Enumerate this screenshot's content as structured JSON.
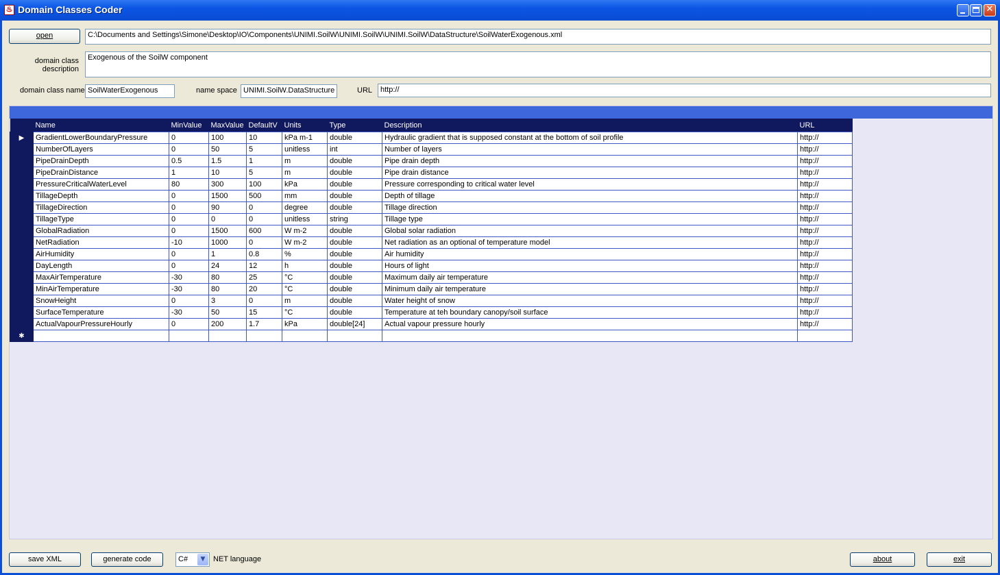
{
  "window": {
    "title": "Domain Classes Coder",
    "app_icon": "app-icon",
    "minimize": "_",
    "maximize": "□",
    "close": "✕"
  },
  "file": {
    "open_label": "open",
    "path": "C:\\Documents and Settings\\Simone\\Desktop\\IO\\Components\\UNIMI.SoilW\\UNIMI.SoilW\\UNIMI.SoilW\\DataStructure\\SoilWaterExogenous.xml"
  },
  "description": {
    "label": "domain class description",
    "value": "Exogenous of the SoilW component"
  },
  "class_name": {
    "label": "domain class name",
    "value": "SoilWaterExogenous"
  },
  "name_space": {
    "label": "name space",
    "value": "UNIMI.SoilW.DataStructure"
  },
  "url": {
    "label": "URL",
    "value": "http://"
  },
  "grid": {
    "columns": [
      "Name",
      "MinValue",
      "MaxValue",
      "DefaultV",
      "Units",
      "Type",
      "Description",
      "URL"
    ],
    "current_row_marker": "▶",
    "new_row_marker": "✱",
    "rows": [
      [
        "GradientLowerBoundaryPressure",
        "0",
        "100",
        "10",
        "kPa m-1",
        "double",
        "Hydraulic gradient that is supposed constant at the bottom of soil profile",
        "http://"
      ],
      [
        "NumberOfLayers",
        "0",
        "50",
        "5",
        "unitless",
        "int",
        "Number of layers",
        "http://"
      ],
      [
        "PipeDrainDepth",
        "0.5",
        "1.5",
        "1",
        "m",
        "double",
        "Pipe drain depth",
        "http://"
      ],
      [
        "PipeDrainDistance",
        "1",
        "10",
        "5",
        "m",
        "double",
        "Pipe drain distance",
        "http://"
      ],
      [
        "PressureCriticalWaterLevel",
        "80",
        "300",
        "100",
        "kPa",
        "double",
        "Pressure corresponding to critical water level",
        "http://"
      ],
      [
        "TillageDepth",
        "0",
        "1500",
        "500",
        "mm",
        "double",
        "Depth of tillage",
        "http://"
      ],
      [
        "TillageDirection",
        "0",
        "90",
        "0",
        "degree",
        "double",
        "Tillage direction",
        "http://"
      ],
      [
        "TillageType",
        "0",
        "0",
        "0",
        "unitless",
        "string",
        "Tillage type",
        "http://"
      ],
      [
        "GlobalRadiation",
        "0",
        "1500",
        "600",
        "W m-2",
        "double",
        "Global solar radiation",
        "http://"
      ],
      [
        "NetRadiation",
        "-10",
        "1000",
        "0",
        "W m-2",
        "double",
        "Net radiation as an optional of temperature model",
        "http://"
      ],
      [
        "AirHumidity",
        "0",
        "1",
        "0.8",
        "%",
        "double",
        "Air humidity",
        "http://"
      ],
      [
        "DayLength",
        "0",
        "24",
        "12",
        "h",
        "double",
        "Hours of light",
        "http://"
      ],
      [
        "MaxAirTemperature",
        "-30",
        "80",
        "25",
        "°C",
        "double",
        "Maximum daily air temperature",
        "http://"
      ],
      [
        "MinAirTemperature",
        "-30",
        "80",
        "20",
        "°C",
        "double",
        "Minimum daily air temperature",
        "http://"
      ],
      [
        "SnowHeight",
        "0",
        "3",
        "0",
        "m",
        "double",
        "Water height of snow",
        "http://"
      ],
      [
        "SurfaceTemperature",
        "-30",
        "50",
        "15",
        "°C",
        "double",
        "Temperature at teh boundary canopy/soil surface",
        "http://"
      ],
      [
        "ActualVapourPressureHourly",
        "0",
        "200",
        "1.7",
        "kPa",
        "double[24]",
        "Actual vapour pressure hourly",
        "http://"
      ]
    ]
  },
  "bottom": {
    "save_label": "save XML",
    "generate_label": "generate code",
    "language_value": "C#",
    "language_label": "NET language",
    "about_label": "about",
    "exit_label": "exit"
  }
}
